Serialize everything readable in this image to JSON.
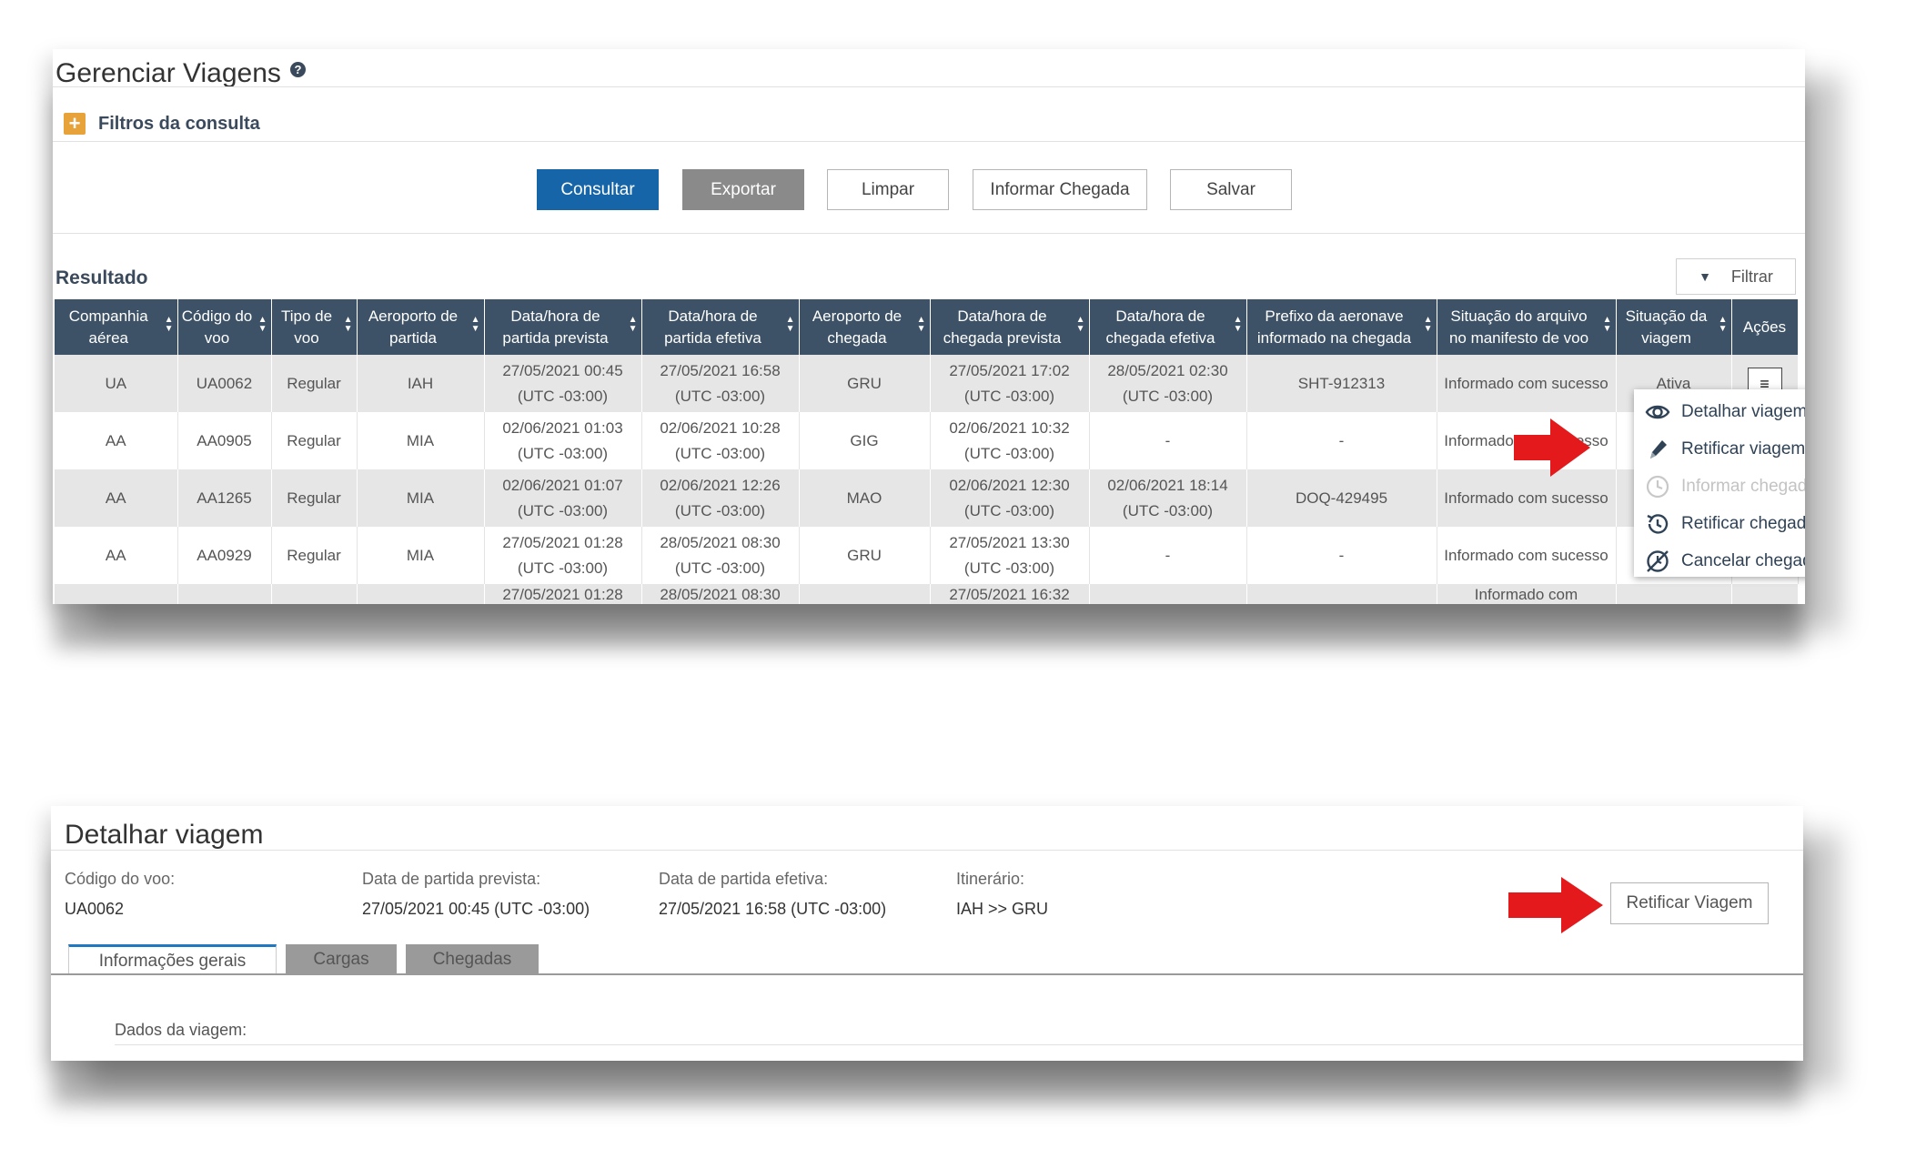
{
  "manage": {
    "title": "Gerenciar Viagens",
    "help_icon": "?",
    "filters_label": "Filtros da consulta",
    "buttons": {
      "consultar": "Consultar",
      "exportar": "Exportar",
      "limpar": "Limpar",
      "informar_chegada": "Informar Chegada",
      "salvar": "Salvar"
    },
    "result_label": "Resultado",
    "filter_button": "Filtrar",
    "table": {
      "headers": [
        "Companhia aérea",
        "Código do voo",
        "Tipo de voo",
        "Aeroporto de partida",
        "Data/hora de partida prevista",
        "Data/hora de partida efetiva",
        "Aeroporto de chegada",
        "Data/hora de chegada prevista",
        "Data/hora de chegada efetiva",
        "Prefixo da aeronave informado na chegada",
        "Situação do arquivo no manifesto de voo",
        "Situação da viagem",
        "Ações"
      ],
      "rows": [
        [
          "UA",
          "UA0062",
          "Regular",
          "IAH",
          "27/05/2021 00:45 (UTC -03:00)",
          "27/05/2021 16:58 (UTC -03:00)",
          "GRU",
          "27/05/2021 17:02 (UTC -03:00)",
          "28/05/2021 02:30 (UTC -03:00)",
          "SHT-912313",
          "Informado com sucesso",
          "Ativa"
        ],
        [
          "AA",
          "AA0905",
          "Regular",
          "MIA",
          "02/06/2021 01:03 (UTC -03:00)",
          "02/06/2021 10:28 (UTC -03:00)",
          "GIG",
          "02/06/2021 10:32 (UTC -03:00)",
          "-",
          "-",
          "Informado com sucesso",
          ""
        ],
        [
          "AA",
          "AA1265",
          "Regular",
          "MIA",
          "02/06/2021 01:07 (UTC -03:00)",
          "02/06/2021 12:26 (UTC -03:00)",
          "MAO",
          "02/06/2021 12:30 (UTC -03:00)",
          "02/06/2021 18:14 (UTC -03:00)",
          "DOQ-429495",
          "Informado com sucesso",
          ""
        ],
        [
          "AA",
          "AA0929",
          "Regular",
          "MIA",
          "27/05/2021 01:28 (UTC -03:00)",
          "28/05/2021 08:30 (UTC -03:00)",
          "GRU",
          "27/05/2021 13:30 (UTC -03:00)",
          "-",
          "-",
          "Informado com sucesso",
          ""
        ],
        [
          "",
          "",
          "",
          "",
          "27/05/2021 01:28",
          "28/05/2021 08:30",
          "",
          "27/05/2021 16:32",
          "",
          "",
          "Informado com",
          ""
        ]
      ],
      "action_icon": "≡"
    },
    "context_menu": [
      {
        "label": "Detalhar viagem",
        "icon": "eye-icon",
        "enabled": true
      },
      {
        "label": "Retificar viagem",
        "icon": "pencil-icon",
        "enabled": true
      },
      {
        "label": "Informar chegada",
        "icon": "clock-icon",
        "enabled": false
      },
      {
        "label": "Retificar chegada",
        "icon": "history-icon",
        "enabled": true
      },
      {
        "label": "Cancelar chegada",
        "icon": "clock-cancel-icon",
        "enabled": true
      }
    ]
  },
  "detail": {
    "title": "Detalhar viagem",
    "fields": [
      {
        "label": "Código do voo:",
        "value": "UA0062"
      },
      {
        "label": "Data de partida prevista:",
        "value": "27/05/2021 00:45 (UTC -03:00)"
      },
      {
        "label": "Data de partida efetiva:",
        "value": "27/05/2021 16:58 (UTC -03:00)"
      },
      {
        "label": "Itinerário:",
        "value": "IAH >> GRU"
      }
    ],
    "rectify_button": "Retificar Viagem",
    "tabs": [
      "Informações gerais",
      "Cargas",
      "Chegadas"
    ],
    "section_label": "Dados da viagem:"
  },
  "colors": {
    "primary": "#1565a8",
    "header": "#3d5266",
    "arrow": "#e3191c",
    "accent": "#e8a23a"
  }
}
